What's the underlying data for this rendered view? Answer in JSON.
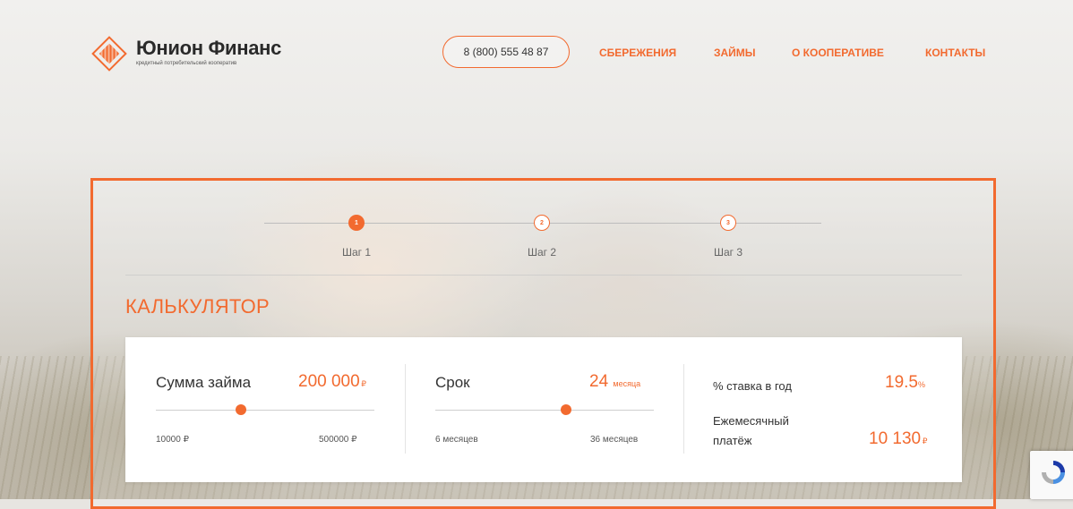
{
  "header": {
    "logo_name": "Юнион Финанс",
    "logo_subtitle": "кредитный потребительский кооператив",
    "phone": "8 (800) 555 48 87",
    "nav": [
      "СБЕРЕЖЕНИЯ",
      "ЗАЙМЫ",
      "О КООПЕРАТИВЕ",
      "КОНТАКТЫ"
    ]
  },
  "steps": [
    {
      "num": "1",
      "label": "Шаг 1",
      "active": true
    },
    {
      "num": "2",
      "label": "Шаг 2",
      "active": false
    },
    {
      "num": "3",
      "label": "Шаг 3",
      "active": false
    }
  ],
  "calculator": {
    "title": "КАЛЬКУЛЯТОР",
    "amount": {
      "label": "Сумма займа",
      "value": "200 000",
      "unit": "₽",
      "min": "10000 ₽",
      "max": "500000 ₽",
      "slider_fraction": 0.39
    },
    "term": {
      "label": "Срок",
      "value": "24",
      "unit": "месяца",
      "min": "6 месяцев",
      "max": "36 месяцев",
      "slider_fraction": 0.6
    },
    "rate": {
      "label": "% ставка в год",
      "value": "19.5",
      "unit": "%"
    },
    "monthly": {
      "label_line1": "Ежемесячный",
      "label_line2": "платёж",
      "value": "10 130",
      "unit": "₽"
    }
  },
  "colors": {
    "accent": "#f26a2f"
  }
}
